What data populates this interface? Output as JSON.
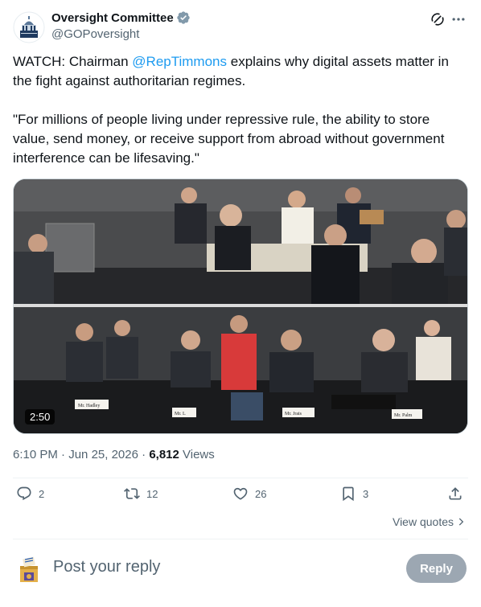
{
  "tweet": {
    "author_name": "Oversight Committee",
    "author_handle": "@GOPoversight",
    "verified": true,
    "icons": {
      "verified": "verified-badge-icon",
      "grok": "grok-icon",
      "more": "more-icon"
    },
    "text": {
      "line1_prefix": "WATCH: Chairman ",
      "mention": "@RepTimmons",
      "line1_suffix": " explains why digital assets matter in the fight against authoritarian regimes.",
      "quote": "\"For millions of people living under repressive rule, the ability to store value, send money, or receive support from abroad without government interference can be lifesaving.\""
    },
    "media": {
      "duration": "2:50",
      "nameplates": [
        "Mr. Hadley",
        "Mr. L",
        "Mr. Jrais",
        "Mr. Palm"
      ]
    },
    "meta": {
      "time": "6:10 PM",
      "separator": " · ",
      "date": "Jun 25, 2026",
      "views_count": "6,812",
      "views_label": " Views"
    },
    "actions": {
      "replies": "2",
      "retweets": "12",
      "likes": "26",
      "bookmarks": "3"
    },
    "view_quotes_label": "View quotes"
  },
  "reply_box": {
    "placeholder": "Post your reply",
    "button_label": "Reply"
  },
  "colors": {
    "accent": "#1d9bf0",
    "text": "#0f1419",
    "muted": "#536471",
    "verified": "#829aab",
    "border": "#eff3f4"
  }
}
